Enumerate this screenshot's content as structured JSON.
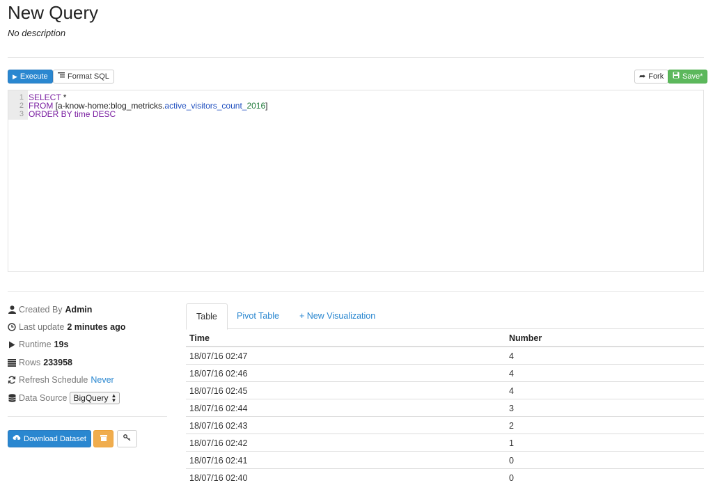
{
  "page": {
    "title": "New Query",
    "description": "No description"
  },
  "toolbar": {
    "execute_label": "Execute",
    "format_label": "Format SQL",
    "fork_label": "Fork",
    "save_label": "Save*"
  },
  "editor": {
    "lines": [
      {
        "num": "1",
        "kw1": "SELECT",
        "rest": " *"
      },
      {
        "num": "2",
        "kw1": "FROM",
        "bracket_open": " [a-know-home:blog_metricks.",
        "table": "active_visitors_count_",
        "year": "2016",
        "bracket_close": "]"
      },
      {
        "num": "3",
        "kw1": "ORDER BY",
        "rest": " time ",
        "kw2": "DESC"
      }
    ]
  },
  "meta": {
    "created_by_label": "Created By",
    "created_by_value": "Admin",
    "last_update_label": "Last update",
    "last_update_value": "2 minutes ago",
    "runtime_label": "Runtime",
    "runtime_value": "19s",
    "rows_label": "Rows",
    "rows_value": "233958",
    "refresh_label": "Refresh Schedule",
    "refresh_value": "Never",
    "datasource_label": "Data Source",
    "datasource_value": "BigQuery"
  },
  "actions": {
    "download_label": "Download Dataset"
  },
  "tabs": {
    "table": "Table",
    "pivot": "Pivot Table",
    "new_vis": "+ New Visualization"
  },
  "results": {
    "columns": [
      "Time",
      "Number"
    ],
    "rows": [
      [
        "18/07/16 02:47",
        "4"
      ],
      [
        "18/07/16 02:46",
        "4"
      ],
      [
        "18/07/16 02:45",
        "4"
      ],
      [
        "18/07/16 02:44",
        "3"
      ],
      [
        "18/07/16 02:43",
        "2"
      ],
      [
        "18/07/16 02:42",
        "1"
      ],
      [
        "18/07/16 02:41",
        "0"
      ],
      [
        "18/07/16 02:40",
        "0"
      ]
    ]
  },
  "colors": {
    "primary": "#2a87d0",
    "success": "#5cb85c",
    "warning": "#f0ad4e"
  }
}
